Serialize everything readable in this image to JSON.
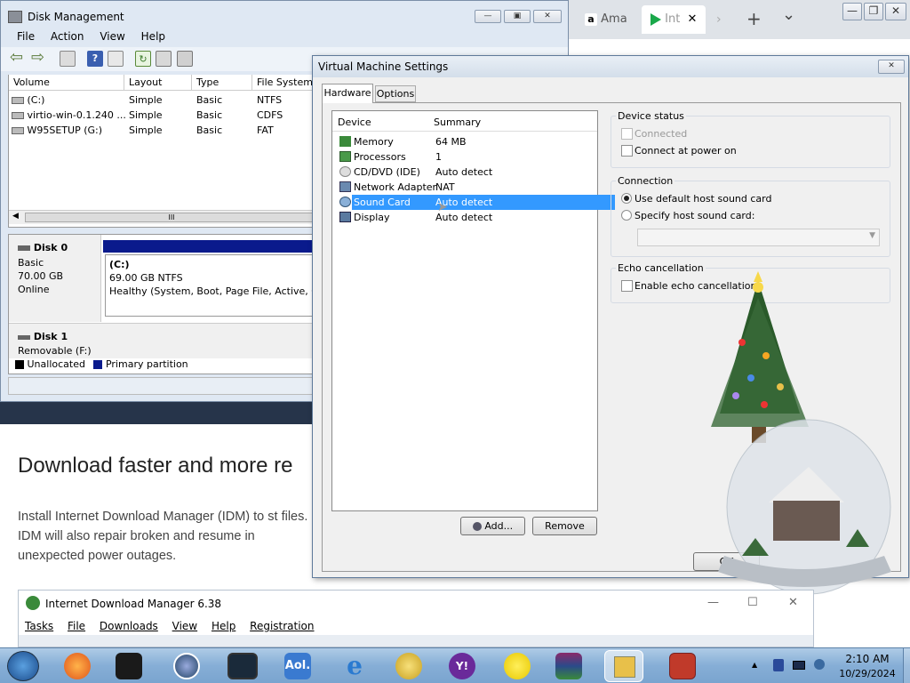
{
  "browser": {
    "tabs": [
      {
        "label": "Ama",
        "icon": "amazon-icon"
      },
      {
        "label": "Int",
        "icon": "play-icon"
      }
    ],
    "new_tab": "+",
    "tab_menu": "⌄",
    "window_buttons": [
      "—",
      "❐",
      "✕"
    ]
  },
  "page": {
    "heading": "Download faster and more re",
    "paragraph": "Install Internet Download Manager (IDM) to st files. IDM will also repair broken and resume in unexpected power outages."
  },
  "disk_mgmt": {
    "title": "Disk Management",
    "menu": [
      "File",
      "Action",
      "View",
      "Help"
    ],
    "columns": [
      "Volume",
      "Layout",
      "Type",
      "File System"
    ],
    "volumes": [
      {
        "volume": "(C:)",
        "layout": "Simple",
        "type": "Basic",
        "fs": "NTFS"
      },
      {
        "volume": "virtio-win-0.1.240 ...",
        "layout": "Simple",
        "type": "Basic",
        "fs": "CDFS"
      },
      {
        "volume": "W95SETUP (G:)",
        "layout": "Simple",
        "type": "Basic",
        "fs": "FAT"
      }
    ],
    "disk0": {
      "name": "Disk 0",
      "kind": "Basic",
      "size": "70.00 GB",
      "state": "Online"
    },
    "partition": {
      "name": "(C:)",
      "size": "69.00 GB NTFS",
      "status": "Healthy (System, Boot, Page File, Active, Cra"
    },
    "disk1": {
      "name": "Disk 1",
      "kind": "Removable (F:)"
    },
    "legend": [
      "Unallocated",
      "Primary partition"
    ],
    "scroll_grip": "III"
  },
  "vm": {
    "title": "Virtual Machine Settings",
    "tabs": [
      "Hardware",
      "Options"
    ],
    "device_col": "Device",
    "summary_col": "Summary",
    "devices": [
      {
        "name": "Memory",
        "summary": "64 MB"
      },
      {
        "name": "Processors",
        "summary": "1"
      },
      {
        "name": "CD/DVD (IDE)",
        "summary": "Auto detect"
      },
      {
        "name": "Network Adapter",
        "summary": "NAT"
      },
      {
        "name": "Sound Card",
        "summary": "Auto detect"
      },
      {
        "name": "Display",
        "summary": "Auto detect"
      }
    ],
    "selected_device": "Sound Card",
    "add_button": "Add...",
    "remove_button": "Remove",
    "ok_button": "OK",
    "device_status": {
      "label": "Device status",
      "connected": "Connected",
      "connect_power": "Connect at power on"
    },
    "connection": {
      "label": "Connection",
      "default": "Use default host sound card",
      "specify": "Specify host sound card:",
      "select_value": ""
    },
    "echo": {
      "label": "Echo cancellation",
      "enable": "Enable echo cancellation"
    }
  },
  "idm": {
    "title": "Internet Download Manager 6.38",
    "menu": [
      "Tasks",
      "File",
      "Downloads",
      "View",
      "Help",
      "Registration"
    ],
    "window_buttons": [
      "—",
      "☐",
      "✕"
    ]
  },
  "taskbar": {
    "icons": [
      "start-orb-icon",
      "firefox-icon",
      "terminal-icon",
      "media-player-icon",
      "monitor-icon",
      "aol-icon",
      "internet-explorer-icon",
      "smiley-messenger-icon",
      "yahoo-icon",
      "smiley-icon",
      "winrar-icon",
      "vmware-icon",
      "toolbox-icon"
    ],
    "time": "2:10 AM",
    "date": "10/29/2024",
    "tray_arrow": "▲"
  },
  "colors": {
    "disk_bar": "#0a1a8c",
    "selection": "#3399ff",
    "taskbar": "#8db4dc",
    "title_bar": "#dfe8f3"
  }
}
